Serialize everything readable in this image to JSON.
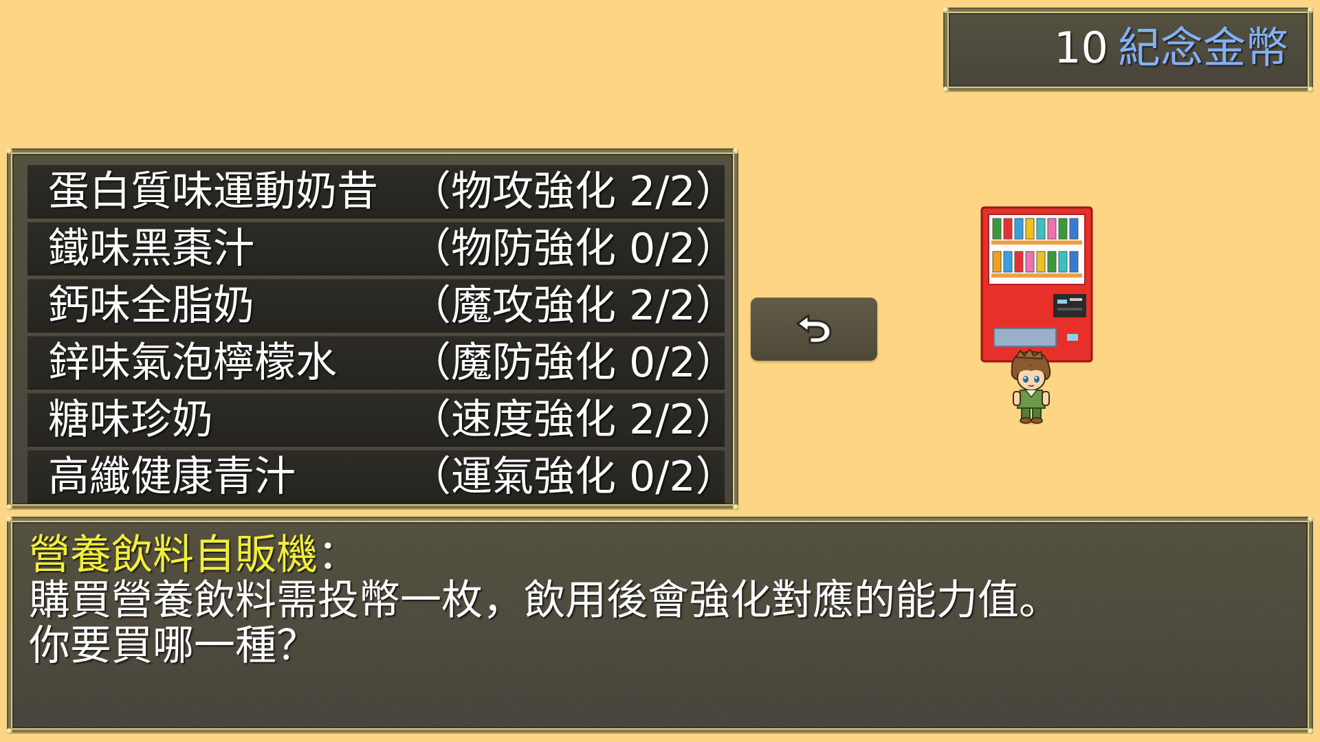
{
  "currency": {
    "amount": "10",
    "unit": "紀念金幣"
  },
  "shop_items": [
    {
      "name": "蛋白質味運動奶昔",
      "effect": "（物攻強化 2/2）"
    },
    {
      "name": "鐵味黑棗汁",
      "effect": "（物防強化 0/2）"
    },
    {
      "name": "鈣味全脂奶",
      "effect": "（魔攻強化 2/2）"
    },
    {
      "name": "鋅味氣泡檸檬水",
      "effect": "（魔防強化 0/2）"
    },
    {
      "name": "糖味珍奶",
      "effect": "（速度強化 2/2）"
    },
    {
      "name": "高纖健康青汁",
      "effect": "（運氣強化 0/2）"
    }
  ],
  "back_button": {
    "icon": "return-arrow-icon"
  },
  "message": {
    "speaker": "營養飲料自販機",
    "colon": "：",
    "lines": [
      "購買營養飲料需投幣一枚，飲用後會強化對應的能力值。",
      "你要買哪一種？"
    ]
  },
  "colors": {
    "background": "#fdd585",
    "window": "#4b473b",
    "speaker_name": "#f2ee3a",
    "currency_unit": "#84b0f8",
    "vending_machine": "#e8302a"
  }
}
